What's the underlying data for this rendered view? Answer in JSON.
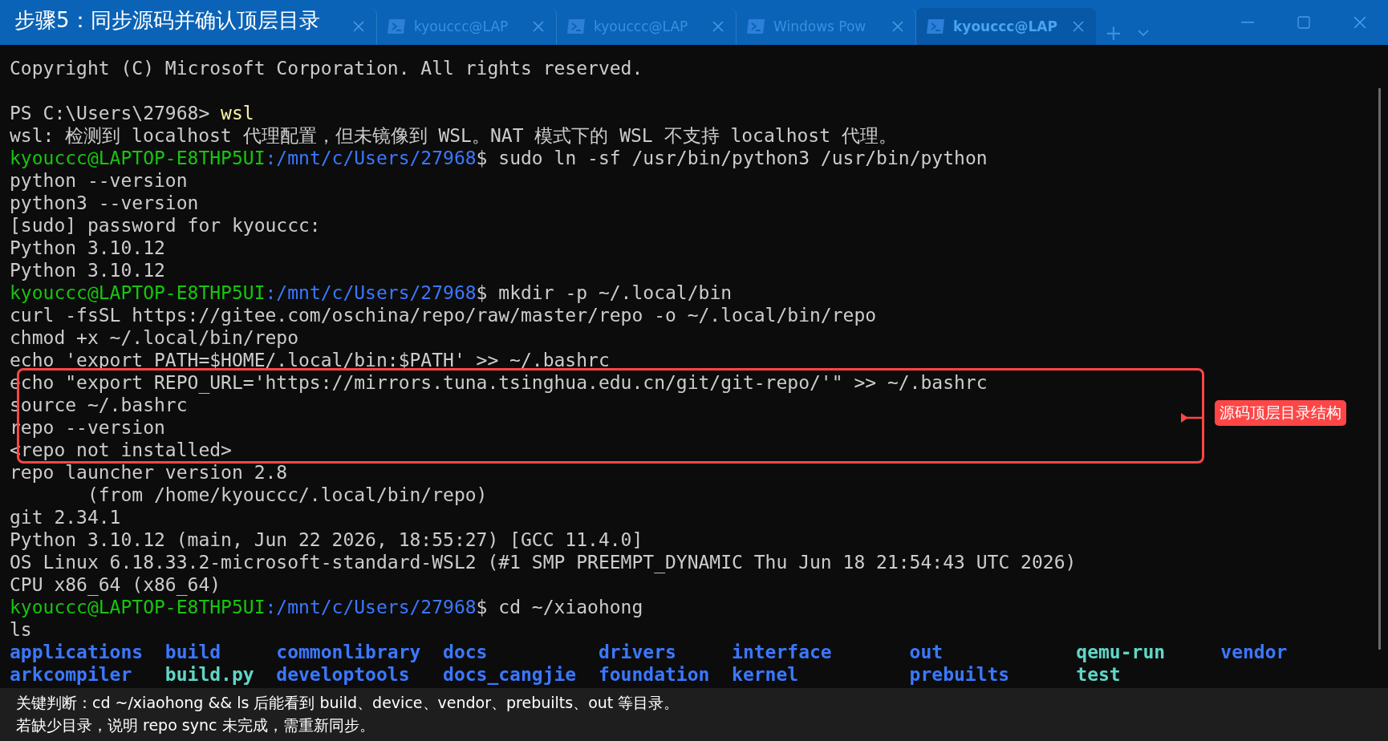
{
  "title_banner": "步骤5：同步源码并确认顶层目录",
  "tabs": [
    {
      "selected": false
    },
    {
      "label": "kyouccc@LAP",
      "selected": false
    },
    {
      "label": "kyouccc@LAP",
      "selected": false
    },
    {
      "label": "Windows Pow",
      "selected": false
    },
    {
      "label": "kyouccc@LAP",
      "selected": true
    }
  ],
  "new_tab": "+",
  "terminal": {
    "lines": [
      {
        "kind": "text",
        "text": "Copyright (C) Microsoft Corporation. All rights reserved."
      },
      {
        "kind": "blank"
      },
      {
        "kind": "ps",
        "prompt": "PS C:\\Users\\27968>",
        "command": "wsl"
      },
      {
        "kind": "text",
        "text": "wsl: 检测到 localhost 代理配置，但未镜像到 WSL。NAT 模式下的 WSL 不支持 localhost 代理。"
      },
      {
        "kind": "prompt",
        "user": "kyouccc@LAPTOP-E8THP5UI",
        "path": ":/mnt/c/Users/27968",
        "command": "$ sudo ln -sf /usr/bin/python3 /usr/bin/python"
      },
      {
        "kind": "text",
        "text": "python --version"
      },
      {
        "kind": "text",
        "text": "python3 --version"
      },
      {
        "kind": "text",
        "text": "[sudo] password for kyouccc:"
      },
      {
        "kind": "text",
        "text": "Python 3.10.12"
      },
      {
        "kind": "text",
        "text": "Python 3.10.12"
      },
      {
        "kind": "prompt",
        "user": "kyouccc@LAPTOP-E8THP5UI",
        "path": ":/mnt/c/Users/27968",
        "command": "$ mkdir -p ~/.local/bin"
      },
      {
        "kind": "text",
        "text": "curl -fsSL https://gitee.com/oschina/repo/raw/master/repo -o ~/.local/bin/repo"
      },
      {
        "kind": "text",
        "text": "chmod +x ~/.local/bin/repo"
      },
      {
        "kind": "text",
        "text": "echo 'export PATH=$HOME/.local/bin:$PATH' >> ~/.bashrc"
      },
      {
        "kind": "text",
        "text": "echo \"export REPO_URL='https://mirrors.tuna.tsinghua.edu.cn/git/git-repo/'\" >> ~/.bashrc"
      },
      {
        "kind": "text",
        "text": "source ~/.bashrc"
      },
      {
        "kind": "text",
        "text": "repo --version"
      },
      {
        "kind": "text",
        "text": "<repo not installed>"
      },
      {
        "kind": "text",
        "text": "repo launcher version 2.8"
      },
      {
        "kind": "text",
        "text": "       (from /home/kyouccc/.local/bin/repo)"
      },
      {
        "kind": "text",
        "text": "git 2.34.1"
      },
      {
        "kind": "text",
        "text": "Python 3.10.12 (main, Jun 22 2026, 18:55:27) [GCC 11.4.0]"
      },
      {
        "kind": "text",
        "text": "OS Linux 6.18.33.2-microsoft-standard-WSL2 (#1 SMP PREEMPT_DYNAMIC Thu Jun 18 21:54:43 UTC 2026)"
      },
      {
        "kind": "text",
        "text": "CPU x86_64 (x86_64)"
      },
      {
        "kind": "prompt",
        "user": "kyouccc@LAPTOP-E8THP5UI",
        "path": ":/mnt/c/Users/27968",
        "command": "$ cd ~/xiaohong"
      },
      {
        "kind": "text",
        "text": "ls"
      }
    ],
    "listing": [
      [
        {
          "name": "applications",
          "kind": "dir"
        },
        {
          "name": "build",
          "kind": "dir"
        },
        {
          "name": "commonlibrary",
          "kind": "dir"
        },
        {
          "name": "docs",
          "kind": "dir"
        },
        {
          "name": "drivers",
          "kind": "dir"
        },
        {
          "name": "interface",
          "kind": "dir"
        },
        {
          "name": "out",
          "kind": "dir"
        },
        {
          "name": "qemu-run",
          "kind": "link"
        },
        {
          "name": "vendor",
          "kind": "dir"
        }
      ],
      [
        {
          "name": "arkcompiler",
          "kind": "dir"
        },
        {
          "name": "build.py",
          "kind": "link"
        },
        {
          "name": "developtools",
          "kind": "dir"
        },
        {
          "name": "docs_cangjie",
          "kind": "dir"
        },
        {
          "name": "foundation",
          "kind": "dir"
        },
        {
          "name": "kernel",
          "kind": "dir"
        },
        {
          "name": "prebuilts",
          "kind": "dir"
        },
        {
          "name": "test",
          "kind": "link"
        }
      ]
    ]
  },
  "callout": {
    "label": "源码顶层目录结构"
  },
  "caption": [
    "关键判断：cd ~/xiaohong && ls 后能看到 build、device、vendor、prebuilts、out 等目录。",
    "若缺少目录，说明 repo sync 未完成，需重新同步。"
  ]
}
